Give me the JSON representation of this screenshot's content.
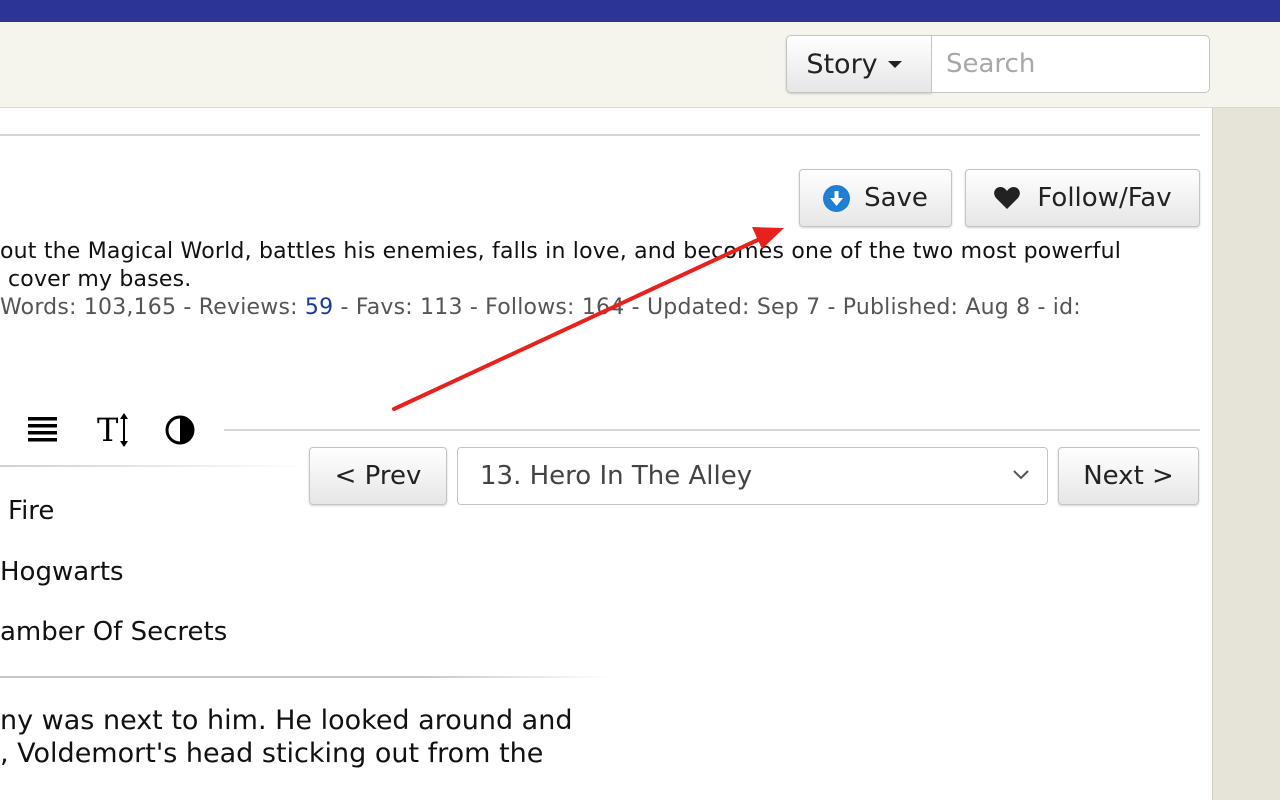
{
  "header": {
    "topbar_text": "",
    "story_dropdown_label": "Story",
    "search_placeholder": "Search"
  },
  "actions": {
    "save_label": "Save",
    "follow_fav_label": "Follow/Fav"
  },
  "summary": {
    "line1": "out the Magical World, battles his enemies, falls in love, and becomes one of the two most powerful",
    "line2": "cover my bases.",
    "meta_words": "Words: 103,165",
    "meta_reviews_label": "Reviews:",
    "meta_reviews_count": "59",
    "meta_rest": "- Favs: 113 - Follows: 164 - Updated: Sep 7 - Published: Aug 8 - id:"
  },
  "toolbar": {
    "icons": [
      "list-width-icon",
      "text-size-icon",
      "contrast-icon"
    ],
    "text_size_glyph": "T"
  },
  "chapter_nav": {
    "prev_label": "< Prev",
    "next_label": "Next >",
    "selected_chapter": "13. Hero In The Alley"
  },
  "chapters_visible": [
    "Fire",
    "Hogwarts",
    "amber Of Secrets"
  ],
  "story_text": {
    "line1": "ny was next to him. He looked around and",
    "line2": ", Voldemort's head sticking out from the"
  },
  "annotation": {
    "arrow_color": "#e8211c"
  },
  "colors": {
    "topbar": "#2d3594",
    "subbar": "#f5f5ed",
    "link": "#1a3c8f",
    "save_icon": "#1e7fd3"
  }
}
